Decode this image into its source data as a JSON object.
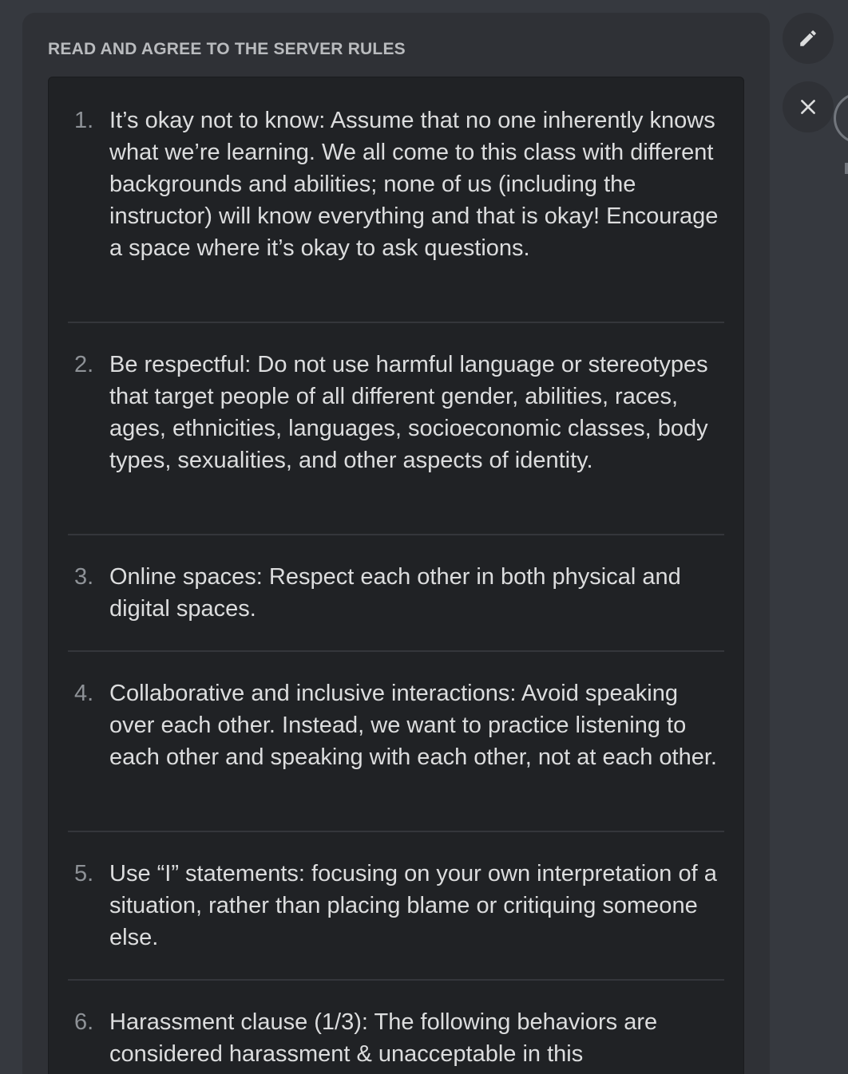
{
  "panel": {
    "heading": "READ AND AGREE TO THE SERVER RULES"
  },
  "rules": [
    {
      "number": "1.",
      "text": "It’s okay not to know: Assume that no one inherently knows what we’re learning. We all come to this class with different backgrounds and abilities; none of us (including the instructor) will know everything and that is okay! Encourage a space where it’s okay to ask questions."
    },
    {
      "number": "2.",
      "text": "Be respectful: Do not use harmful language or stereotypes that target people of all different gender, abilities, races, ages, ethnicities, languages, socioeconomic classes, body types, sexualities, and other aspects of identity."
    },
    {
      "number": "3.",
      "text": "Online spaces: Respect each other in both physical and digital spaces."
    },
    {
      "number": "4.",
      "text": "Collaborative and inclusive interactions: Avoid speaking over each other. Instead, we want to practice listening to each other and speaking with each other, not at each other."
    },
    {
      "number": "5.",
      "text": "Use “I” statements: focusing on your own interpretation of a situation, rather than placing blame or critiquing someone else."
    },
    {
      "number": "6.",
      "text": "Harassment clause (1/3): The following behaviors are considered harassment & unacceptable in this"
    }
  ],
  "actions": {
    "edit_icon": "pencil-icon",
    "close_icon": "close-icon"
  },
  "colors": {
    "background": "#36393f",
    "panel": "#2f3136",
    "rules_box": "#202225",
    "text": "#dcddde",
    "muted": "#8e9297"
  }
}
